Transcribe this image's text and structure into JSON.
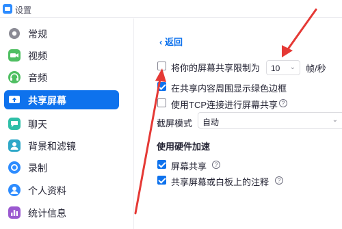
{
  "window": {
    "title": "设置"
  },
  "sidebar": {
    "items": [
      {
        "label": "常规",
        "icon": "gear-icon",
        "color": "#8b8b95",
        "active": false
      },
      {
        "label": "视频",
        "icon": "video-icon",
        "color": "#4fbf62",
        "active": false
      },
      {
        "label": "音频",
        "icon": "headphones-icon",
        "color": "#4fbf62",
        "active": false
      },
      {
        "label": "共享屏幕",
        "icon": "share-screen-icon",
        "color": "#ffffff",
        "active": true
      },
      {
        "label": "聊天",
        "icon": "chat-icon",
        "color": "#2fbfa8",
        "active": false
      },
      {
        "label": "背景和滤镜",
        "icon": "person-background-icon",
        "color": "#2fa8c8",
        "active": false
      },
      {
        "label": "录制",
        "icon": "record-icon",
        "color": "#2d8cff",
        "active": false
      },
      {
        "label": "个人资料",
        "icon": "profile-icon",
        "color": "#2d8cff",
        "active": false
      },
      {
        "label": "统计信息",
        "icon": "statistics-icon",
        "color": "#9b59d0",
        "active": false
      }
    ]
  },
  "content": {
    "back_label": "返回",
    "limit_option": {
      "label": "将你的屏幕共享限制为",
      "checked": false
    },
    "fps_select": {
      "value": "10",
      "unit": "帧/秒"
    },
    "green_border_option": {
      "label": "在共享内容周围显示绿色边框",
      "checked": true
    },
    "tcp_option": {
      "label": "使用TCP连接进行屏幕共享",
      "checked": false
    },
    "capture_mode": {
      "label": "截屏模式",
      "value": "自动"
    },
    "hardware_section_title": "使用硬件加速",
    "hw_screen_share": {
      "label": "屏幕共享",
      "checked": true
    },
    "hw_annotation": {
      "label": "共享屏幕或白板上的注释",
      "checked": true
    },
    "help_glyph": "?"
  },
  "annotation_color": "#e53935",
  "accent_color": "#0e72ed"
}
